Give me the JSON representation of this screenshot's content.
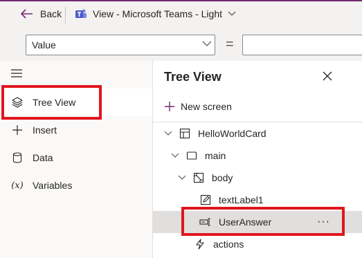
{
  "topbar": {
    "back_label": "Back",
    "view_label": "View - Microsoft Teams - Light"
  },
  "formula_bar": {
    "property_value": "Value",
    "equals": "=",
    "formula_value": ""
  },
  "left_nav": {
    "items": [
      {
        "label": "Tree View",
        "icon": "layers-icon"
      },
      {
        "label": "Insert",
        "icon": "plus-icon"
      },
      {
        "label": "Data",
        "icon": "database-icon"
      },
      {
        "label": "Variables",
        "icon": "variables-icon",
        "icon_text": "(x)"
      }
    ]
  },
  "tree_view": {
    "title": "Tree View",
    "new_screen_label": "New screen",
    "nodes": [
      {
        "label": "HelloWorldCard",
        "icon": "card-icon"
      },
      {
        "label": "main",
        "icon": "container-icon"
      },
      {
        "label": "body",
        "icon": "body-icon"
      },
      {
        "label": "textLabel1",
        "icon": "edit-text-icon"
      },
      {
        "label": "UserAnswer",
        "icon": "text-input-icon"
      },
      {
        "label": "actions",
        "icon": "lightning-icon"
      }
    ],
    "more_label": "···"
  },
  "colors": {
    "highlight_red": "#e0161f",
    "brand_purple": "#742774",
    "selected_row": "#e1dfdd"
  }
}
